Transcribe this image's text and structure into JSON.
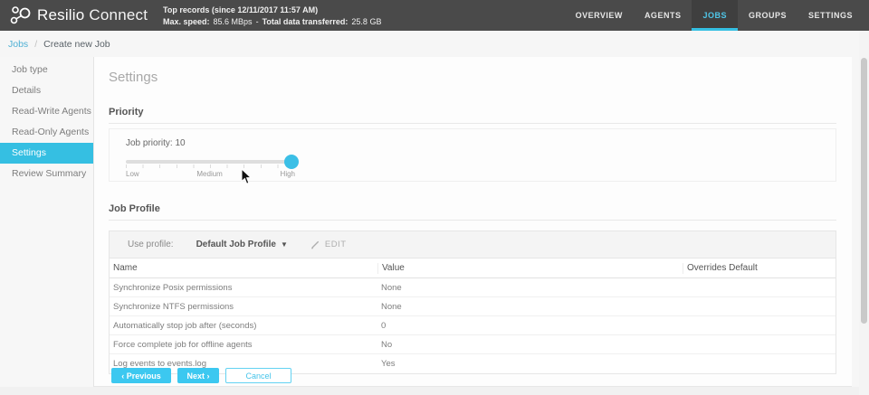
{
  "topbar": {
    "brand_name": "Resilio",
    "brand_suffix": "Connect",
    "stats": {
      "line1": "Top records (since  12/11/2017 11:57 AM)",
      "max_speed_label": "Max. speed:",
      "max_speed_value": "85.6 MBps",
      "separator": "-",
      "total_label": "Total data transferred:",
      "total_value": "25.8 GB"
    },
    "nav": [
      {
        "label": "OVERVIEW",
        "active": false
      },
      {
        "label": "AGENTS",
        "active": false
      },
      {
        "label": "JOBS",
        "active": true
      },
      {
        "label": "GROUPS",
        "active": false
      },
      {
        "label": "SETTINGS",
        "active": false
      }
    ]
  },
  "breadcrumb": {
    "link": "Jobs",
    "separator": "/",
    "current": "Create new Job"
  },
  "sidebar": {
    "items": [
      {
        "label": "Job type",
        "active": false
      },
      {
        "label": "Details",
        "active": false
      },
      {
        "label": "Read-Write Agents",
        "active": false
      },
      {
        "label": "Read-Only Agents",
        "active": false
      },
      {
        "label": "Settings",
        "active": true
      },
      {
        "label": "Review Summary",
        "active": false
      }
    ]
  },
  "main": {
    "title": "Settings",
    "priority": {
      "heading": "Priority",
      "label": "Job priority: 10",
      "slider": {
        "min_label": "Low",
        "mid_label": "Medium",
        "max_label": "High",
        "value": 10
      }
    },
    "job_profile": {
      "heading": "Job Profile",
      "use_profile_label": "Use profile:",
      "selected_profile": "Default Job Profile",
      "edit_label": "EDIT",
      "table": {
        "columns": [
          "Name",
          "Value",
          "Overrides Default"
        ],
        "rows": [
          {
            "name": "Synchronize Posix permissions",
            "value": "None",
            "overrides": ""
          },
          {
            "name": "Synchronize NTFS permissions",
            "value": "None",
            "overrides": ""
          },
          {
            "name": "Automatically stop job after (seconds)",
            "value": "0",
            "overrides": ""
          },
          {
            "name": "Force complete job for offline agents",
            "value": "No",
            "overrides": ""
          },
          {
            "name": "Log events to events.log",
            "value": "Yes",
            "overrides": ""
          }
        ]
      }
    }
  },
  "footer": {
    "previous": "‹ Previous",
    "next": "Next ›",
    "cancel": "Cancel"
  },
  "colors": {
    "topbar_bg": "#4a4a4a",
    "accent": "#35bfe2",
    "button": "#3cc8f0",
    "breadcrumb_link": "#4fb0d4"
  }
}
